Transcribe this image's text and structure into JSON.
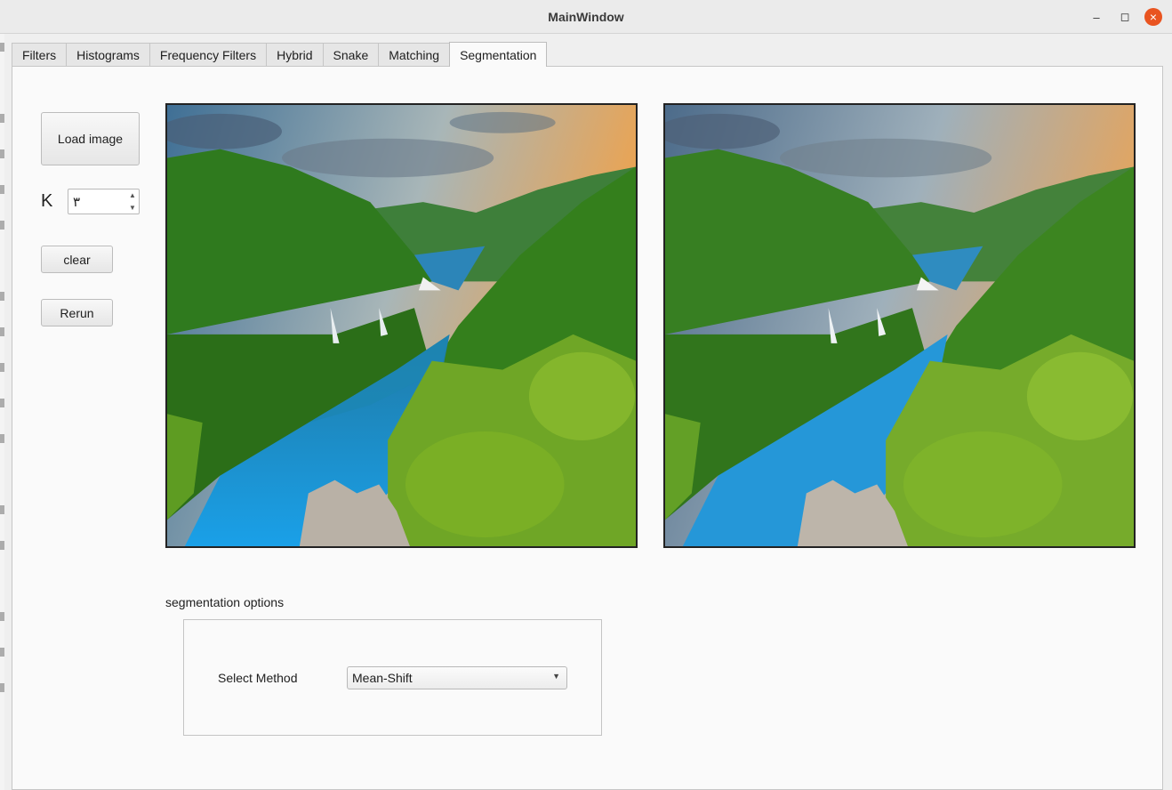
{
  "window": {
    "title": "MainWindow",
    "controls": [
      "minimize-icon",
      "maximize-icon",
      "close-icon"
    ]
  },
  "tabs": [
    {
      "label": "Filters",
      "active": false
    },
    {
      "label": "Histograms",
      "active": false
    },
    {
      "label": "Frequency Filters",
      "active": false
    },
    {
      "label": "Hybrid",
      "active": false
    },
    {
      "label": "Snake",
      "active": false
    },
    {
      "label": "Matching",
      "active": false
    },
    {
      "label": "Segmentation",
      "active": true
    }
  ],
  "controls": {
    "load_image_label": "Load image",
    "k_label": "K",
    "k_value": "٣",
    "clear_label": "clear",
    "rerun_label": "Rerun"
  },
  "options": {
    "section_label": "segmentation options",
    "select_method_label": "Select Method",
    "selected_method": "Mean-Shift"
  },
  "colors": {
    "accent_close": "#e95420",
    "water": "#1a8fd0",
    "forest": "#3d8a1e"
  }
}
